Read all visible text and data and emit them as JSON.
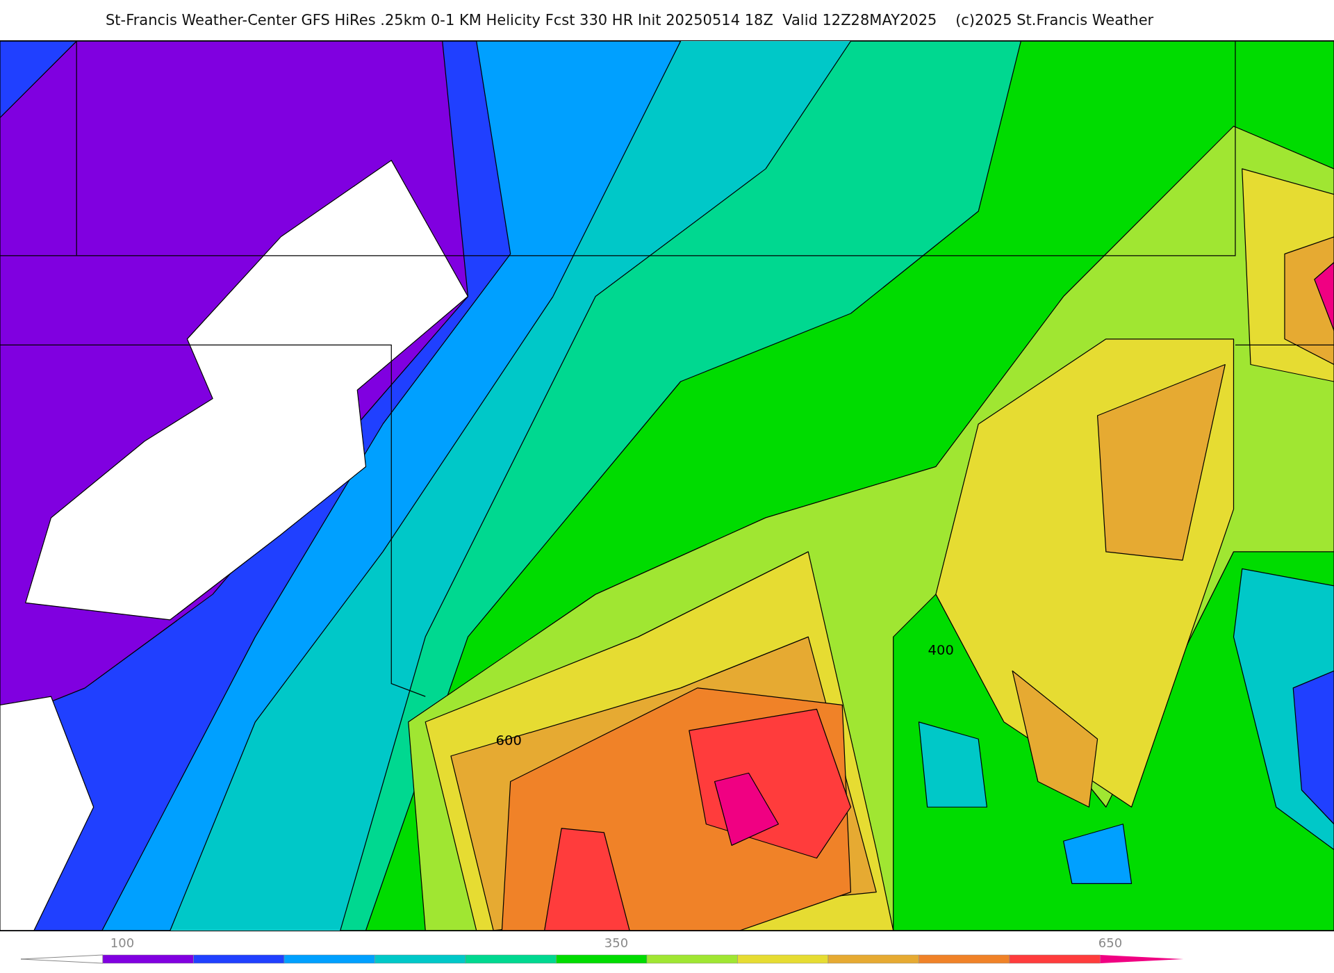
{
  "title": "St-Francis Weather-Center GFS HiRes .25km 0-1 KM Helicity Fcst 330 HR Init 20250514 18Z  Valid 12Z28MAY2025    (c)2025 St.Francis Weather",
  "map": {
    "contour_labels": [
      "600",
      "400"
    ]
  },
  "colorbar": {
    "labels": [
      "100",
      "350",
      "650"
    ],
    "bins": [
      {
        "color": "#8000e0"
      },
      {
        "color": "#2040ff"
      },
      {
        "color": "#00a0ff"
      },
      {
        "color": "#00c8c8"
      },
      {
        "color": "#00d890"
      },
      {
        "color": "#00dc00"
      },
      {
        "color": "#a0e632"
      },
      {
        "color": "#e6dc32"
      },
      {
        "color": "#e6aa32"
      },
      {
        "color": "#f08228"
      },
      {
        "color": "#ff3c3c"
      },
      {
        "color": "#f00082"
      }
    ]
  }
}
